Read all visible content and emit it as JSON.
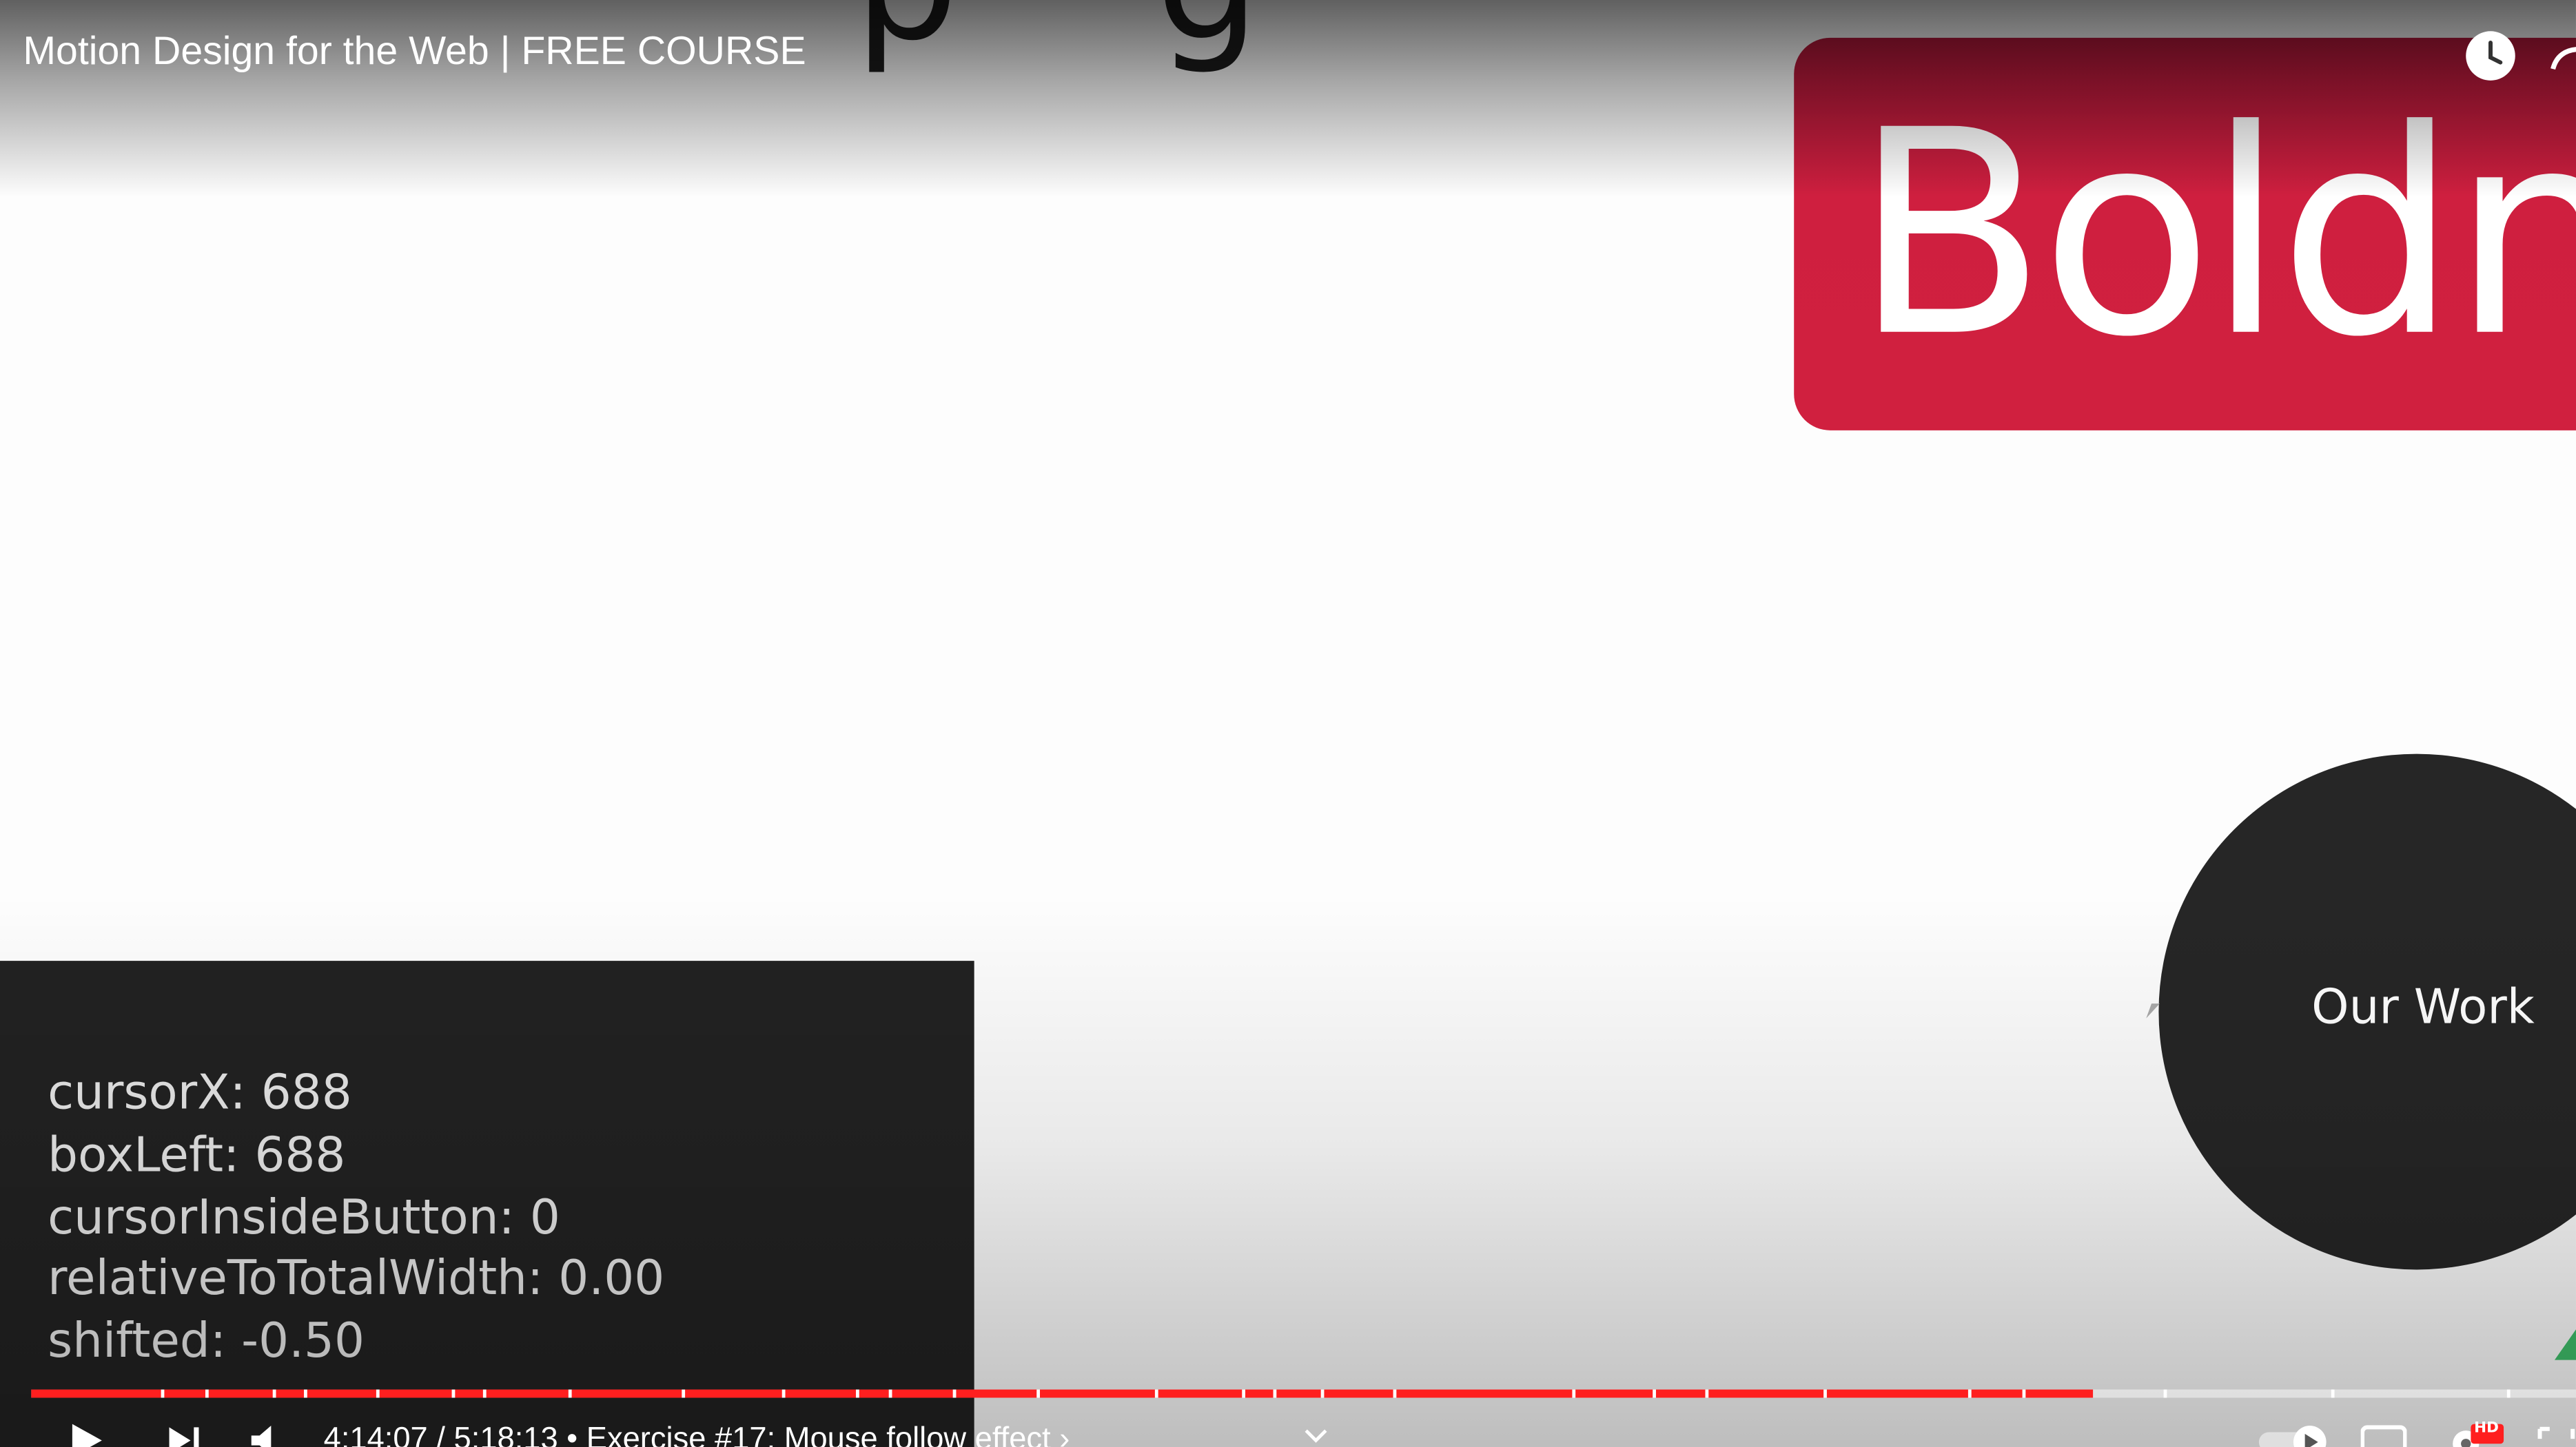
{
  "video": {
    "title": "Motion Design for the Web | FREE COURSE",
    "playback": {
      "current_time": "4:14:07",
      "duration": "5:18:13",
      "separator": " / ",
      "chapter_bullet": " • ",
      "chapter": "Exercise #17: Mouse follow effect",
      "chapter_arrow": " ›",
      "progress_fraction": 0.81
    },
    "icons": {
      "watch_later": "clock-icon",
      "share": "share-icon",
      "play": "play-icon",
      "next": "next-icon",
      "volume": "volume-icon",
      "autoplay": "autoplay-toggle-icon",
      "captions": "cc-icon",
      "settings": "settings-gear-icon",
      "hd_badge": "HD",
      "miniplayer": "miniplayer-icon"
    }
  },
  "content": {
    "bold_card_text": "Boldn",
    "top_glyphs": "pg",
    "circle_button_label": "Our Work",
    "debug": [
      {
        "key": "cursorX",
        "value": "688"
      },
      {
        "key": "boxLeft",
        "value": "688"
      },
      {
        "key": "cursorInsideButton",
        "value": "0"
      },
      {
        "key": "relativeToTotalWidth",
        "value": "0.00"
      },
      {
        "key": "shifted",
        "value": "-0.50"
      }
    ]
  },
  "colors": {
    "card_red": "#d0203f",
    "progress_red": "#ff1f1f",
    "panel_dark": "#222222",
    "circle_dark": "#262626"
  }
}
